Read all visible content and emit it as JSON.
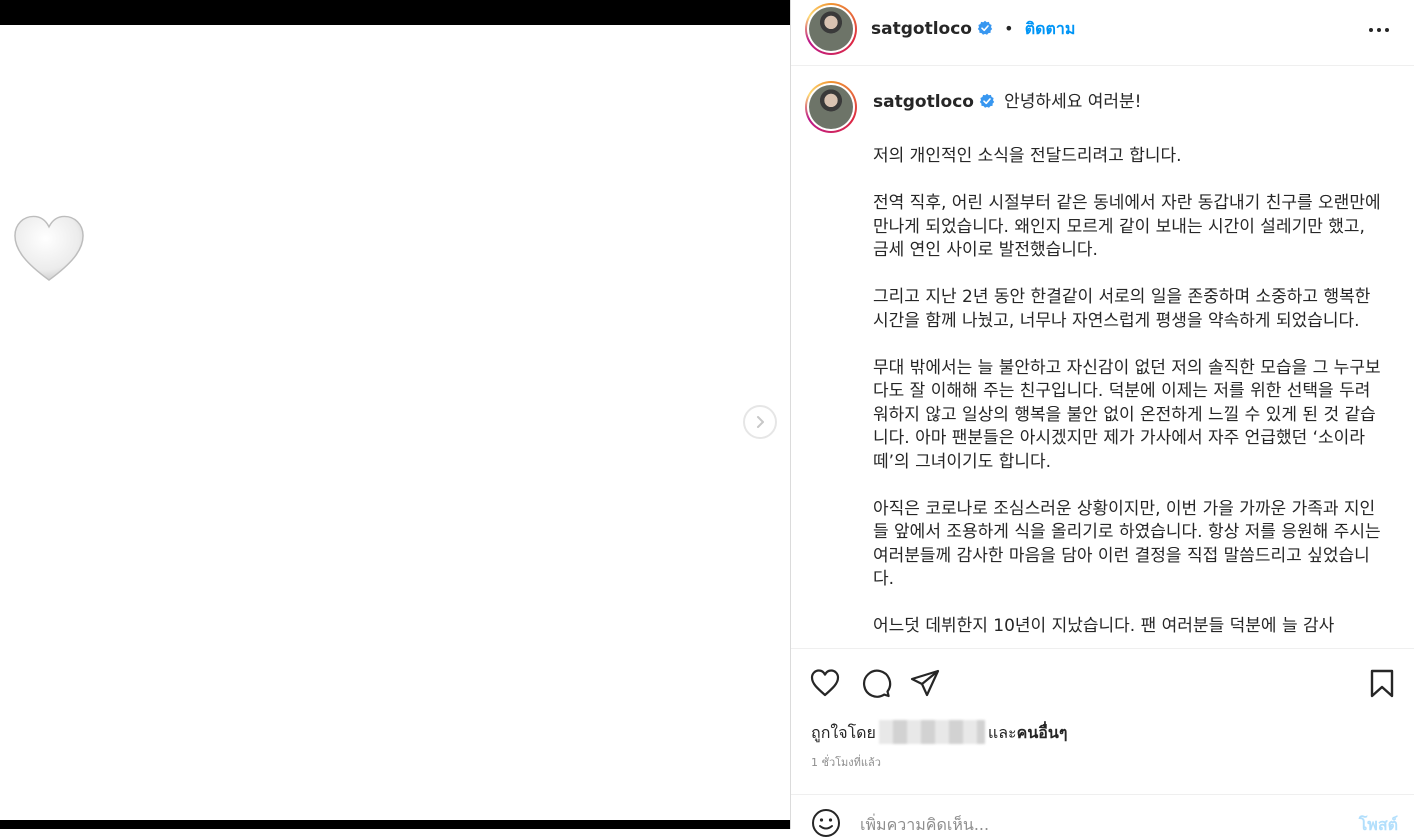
{
  "account": {
    "username": "satgotloco",
    "follow_label": "ติดตาม",
    "separator": "•"
  },
  "caption": {
    "username": "satgotloco",
    "first_line": "안녕하세요 여러분!",
    "body": "저의 개인적인 소식을 전달드리려고 합니다.\n\n전역 직후, 어린 시절부터 같은 동네에서 자란 동갑내기 친구를 오랜만에 만나게 되었습니다. 왜인지 모르게 같이 보내는 시간이 설레기만 했고, 금세 연인 사이로 발전했습니다.\n\n그리고 지난 2년 동안 한결같이 서로의 일을 존중하며 소중하고 행복한 시간을 함께 나눴고, 너무나 자연스럽게 평생을 약속하게 되었습니다.\n\n무대 밖에서는 늘 불안하고 자신감이 없던 저의 솔직한 모습을 그 누구보다도 잘 이해해 주는 친구입니다. 덕분에 이제는 저를 위한 선택을 두려워하지 않고 일상의 행복을 불안 없이 온전하게 느낄 수 있게 된 것 같습니다. 아마 팬분들은 아시겠지만 제가 가사에서 자주 언급했던 ‘소이라떼’의 그녀이기도 합니다.\n\n아직은 코로나로 조심스러운 상황이지만, 이번 가을 가까운 가족과 지인들 앞에서 조용하게 식을 올리기로 하였습니다. 항상 저를 응원해 주시는 여러분들께 감사한 마음을 담아 이런 결정을 직접 말씀드리고 싶었습니다.\n\n어느덧 데뷔한지 10년이 지났습니다. 팬 여러분들 덕분에 늘 감사"
  },
  "likes": {
    "prefix": "ถูกใจโดย",
    "suffix_and": "และ",
    "suffix_others": "คนอื่นๆ"
  },
  "time_ago": "1 ชั่วโมงที่แล้ว",
  "comment": {
    "placeholder": "เพิ่มความคิดเห็น...",
    "post_label": "โพสต์"
  },
  "icons": {
    "media": "white-heart-icon",
    "next": "chevron-right-icon",
    "like": "heart-icon",
    "comment": "comment-icon",
    "share": "paper-plane-icon",
    "save": "bookmark-icon",
    "emoji": "smiley-icon",
    "more": "more-horizontal-icon",
    "verified": "verified-badge-icon"
  },
  "colors": {
    "link_blue": "#0095f6",
    "verified_blue": "#3897f0",
    "post_disabled": "#b2dffc",
    "text": "#262626",
    "muted": "#8e8e8e"
  }
}
